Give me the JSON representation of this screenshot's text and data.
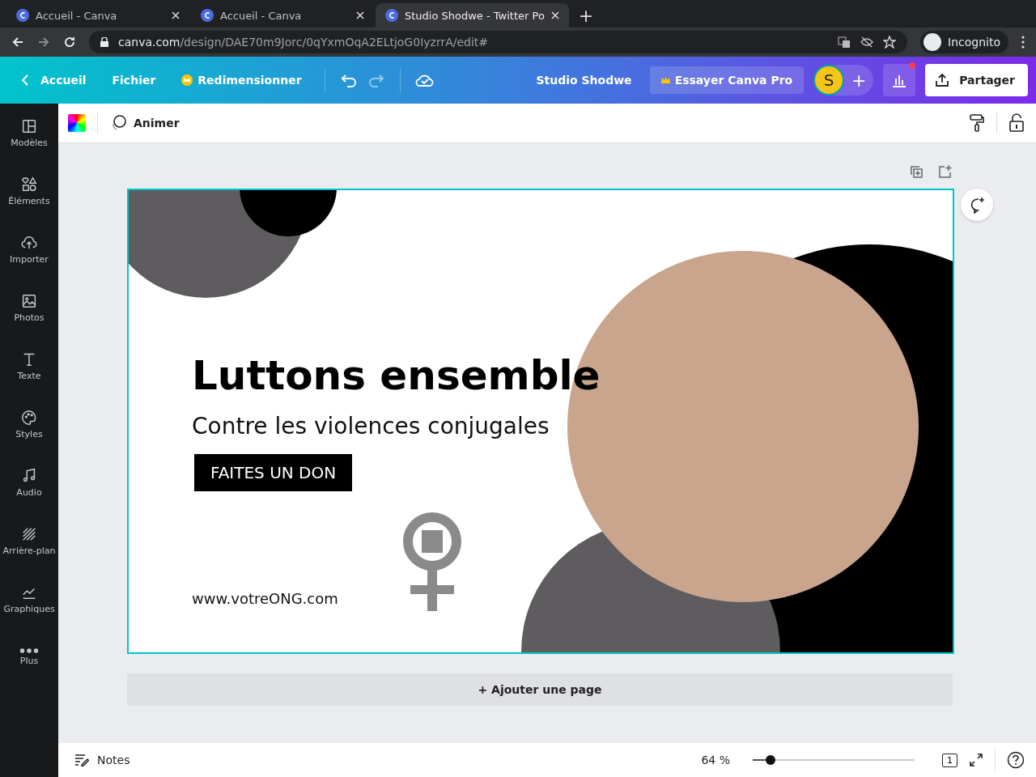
{
  "browser": {
    "tabs": [
      {
        "title": "Accueil - Canva",
        "selected": false
      },
      {
        "title": "Accueil - Canva",
        "selected": false
      },
      {
        "title": "Studio Shodwe - Twitter Po",
        "selected": true
      }
    ],
    "new_tab": "+",
    "address": {
      "host": "canva.com",
      "path": "/design/DAE70m9Jorc/0qYxmOqA2ELtjoG0IyzrrA/edit#"
    },
    "profile": "Incognito"
  },
  "header": {
    "back": "Accueil",
    "menu": [
      "Fichier",
      "Redimensionner"
    ],
    "project": "Studio Shodwe",
    "pro": "Essayer Canva Pro",
    "avatar": "S",
    "add": "+",
    "share": "Partager"
  },
  "sidebar": {
    "items": [
      {
        "label": "Modèles",
        "kind": "layout"
      },
      {
        "label": "Éléments",
        "kind": "shapes"
      },
      {
        "label": "Importer",
        "kind": "upload"
      },
      {
        "label": "Photos",
        "kind": "image"
      },
      {
        "label": "Texte",
        "kind": "text"
      },
      {
        "label": "Styles",
        "kind": "palette"
      },
      {
        "label": "Audio",
        "kind": "music"
      },
      {
        "label": "Arrière-plan",
        "kind": "stripes"
      },
      {
        "label": "Graphiques",
        "kind": "chart"
      },
      {
        "label": "Plus",
        "kind": "more"
      }
    ]
  },
  "toolbar": {
    "animate": "Animer"
  },
  "design": {
    "title": "Luttons ensemble",
    "subtitle": "Contre les violences conjugales",
    "cta": "FAITES UN DON",
    "website": "www.votreONG.com"
  },
  "add_page": "+ Ajouter une page",
  "footer": {
    "notes": "Notes",
    "zoom": {
      "reading": "64 %",
      "level": 0.11
    },
    "pages": "1"
  }
}
